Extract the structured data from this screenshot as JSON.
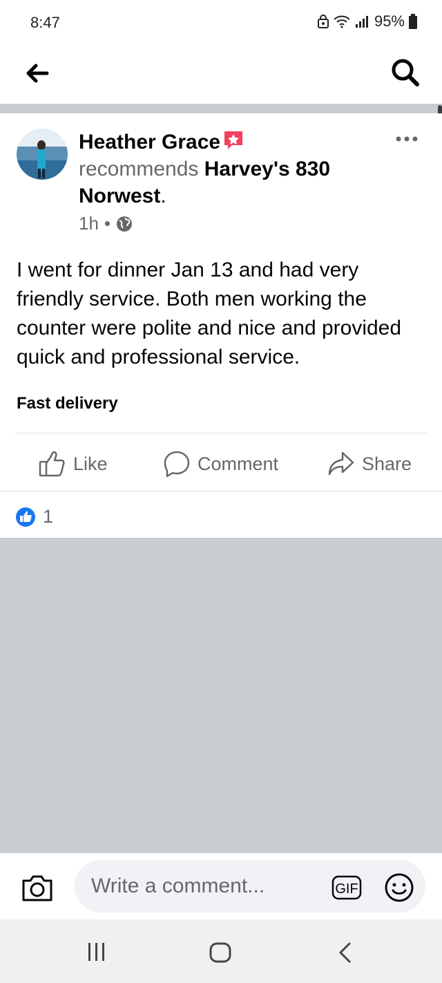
{
  "status_bar": {
    "time": "8:47",
    "battery": "95%",
    "icons": [
      "lock-icon",
      "wifi-icon",
      "signal-icon",
      "battery-icon"
    ]
  },
  "app_bar": {
    "back_icon": "arrow-left-icon",
    "search_icon": "search-icon"
  },
  "post": {
    "author": "Heather Grace",
    "author_badge_icon": "star-badge-icon",
    "recommends_text": "recommends",
    "place": "Harvey's 830 Norwest",
    "period": ".",
    "time_ago": "1h",
    "separator": "•",
    "privacy_icon": "globe-icon",
    "body": "I went for dinner Jan 13 and had very friendly service. Both men working the counter were polite and nice and provided quick and professional service.",
    "tag": "Fast delivery",
    "actions": {
      "like": "Like",
      "comment": "Comment",
      "share": "Share"
    },
    "reaction_count": "1"
  },
  "comment_bar": {
    "placeholder": "Write a comment...",
    "gif_label": "GIF"
  },
  "colors": {
    "accent_blue": "#1877f2",
    "secondary_text": "#65676b",
    "badge_pink": "#f3425f",
    "grey_bg": "#c9ccd1"
  }
}
